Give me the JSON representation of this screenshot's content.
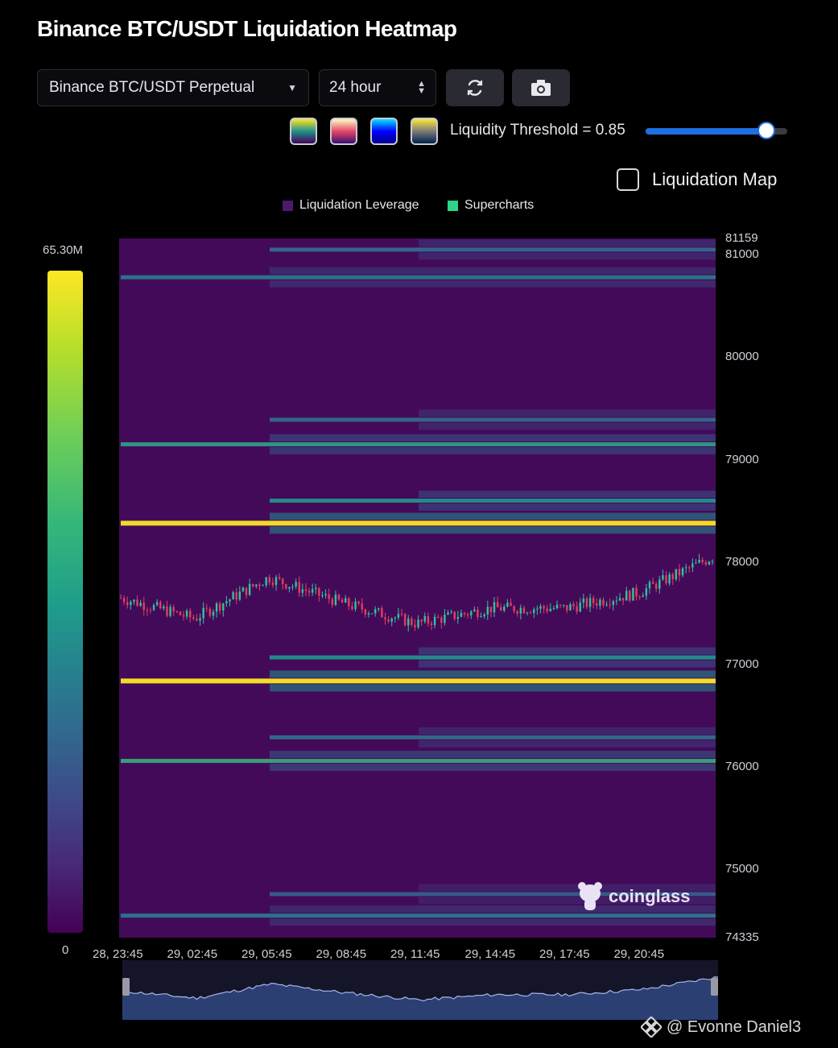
{
  "header": {
    "title": "Binance BTC/USDT Liquidation Heatmap"
  },
  "controls": {
    "pair_select": "Binance BTC/USDT Perpetual",
    "range_select": "24 hour",
    "refresh_icon": "refresh-icon",
    "camera_icon": "camera-icon",
    "palettes": [
      {
        "name": "viridis",
        "top": "#fde725",
        "mid": "#21918c",
        "bottom": "#440154"
      },
      {
        "name": "magma",
        "top": "#fcfdbf",
        "mid": "#e5466b",
        "bottom": "#3b0f70"
      },
      {
        "name": "jet",
        "top": "#00e5ff",
        "mid": "#0000ff",
        "bottom": "#00008b"
      },
      {
        "name": "cividis",
        "top": "#fee838",
        "mid": "#7c7b78",
        "bottom": "#00204c"
      }
    ],
    "threshold_label": "Liquidity Threshold = 0.85",
    "threshold_value": 0.85,
    "liquidation_map_label": "Liquidation Map",
    "liquidation_map_checked": false
  },
  "legend": [
    {
      "label": "Liquidation Leverage",
      "color": "#4a1a6b"
    },
    {
      "label": "Supercharts",
      "color": "#2dd48a"
    }
  ],
  "colorbar": {
    "max_label": "65.30M",
    "min_label": "0"
  },
  "chart_data": {
    "type": "heatmap",
    "title": "Binance BTC/USDT Liquidation Heatmap",
    "background_color": "#440a5a",
    "y_axis": {
      "min": 74335,
      "max": 81159,
      "ticks": [
        81159,
        81000,
        80000,
        79000,
        78000,
        77000,
        76000,
        75000,
        74335
      ]
    },
    "x_axis": {
      "ticks": [
        "28, 23:45",
        "29, 02:45",
        "29, 05:45",
        "29, 08:45",
        "29, 11:45",
        "29, 14:45",
        "29, 17:45",
        "29, 20:45"
      ]
    },
    "liquidation_levels": [
      {
        "price": 81050,
        "start": "29, 05:45",
        "intensity": 0.35
      },
      {
        "price": 80780,
        "start": "28, 23:45",
        "intensity": 0.4
      },
      {
        "price": 79390,
        "start": "29, 05:45",
        "intensity": 0.35
      },
      {
        "price": 79150,
        "start": "28, 23:45",
        "intensity": 0.55
      },
      {
        "price": 78600,
        "start": "29, 05:45",
        "intensity": 0.5
      },
      {
        "price": 78380,
        "start": "28, 23:45",
        "intensity": 1.0
      },
      {
        "price": 77070,
        "start": "29, 05:45",
        "intensity": 0.5
      },
      {
        "price": 76840,
        "start": "28, 23:45",
        "intensity": 1.0
      },
      {
        "price": 76290,
        "start": "29, 05:45",
        "intensity": 0.35
      },
      {
        "price": 76060,
        "start": "28, 23:45",
        "intensity": 0.6
      },
      {
        "price": 74760,
        "start": "29, 05:45",
        "intensity": 0.3
      },
      {
        "price": 74550,
        "start": "28, 23:45",
        "intensity": 0.4
      }
    ],
    "price_series": {
      "times": [
        "28, 23:45",
        "29, 02:45",
        "29, 05:45",
        "29, 08:45",
        "29, 11:45",
        "29, 14:45",
        "29, 17:45",
        "29, 20:45",
        "29, 23:45"
      ],
      "close": [
        77650,
        77450,
        77850,
        77600,
        77400,
        77550,
        77550,
        77700,
        78050
      ]
    }
  },
  "watermark": "coinglass",
  "footer": {
    "text": "@ Evonne Daniel3"
  }
}
